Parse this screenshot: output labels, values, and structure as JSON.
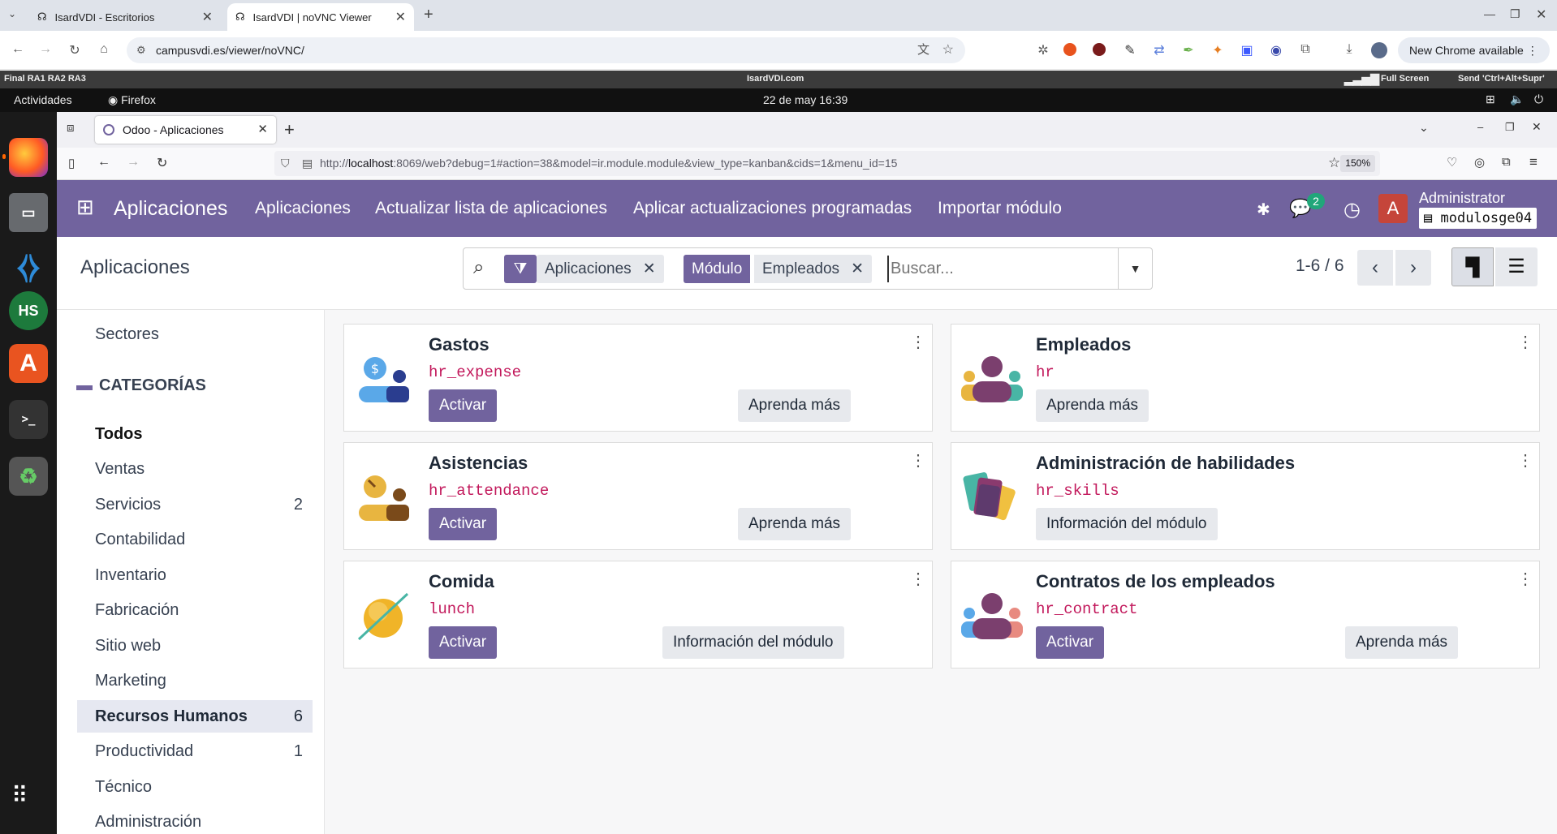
{
  "chrome": {
    "tabs": [
      {
        "title": "IsardVDI - Escritorios"
      },
      {
        "title": "IsardVDI | noVNC Viewer"
      }
    ],
    "url": "campusvdi.es/viewer/noVNC/",
    "new_chrome": "New Chrome available"
  },
  "vnc": {
    "left": "Final RA1 RA2 RA3",
    "center": "IsardVDI.com",
    "fullscreen": "Full Screen",
    "send": "Send 'Ctrl+Alt+Supr'"
  },
  "gnome": {
    "activities": "Actividades",
    "app": "Firefox",
    "datetime": "22 de may  16:39"
  },
  "firefox": {
    "tab_title": "Odoo - Aplicaciones",
    "url_prefix": "http://",
    "url_host": "localhost",
    "url_rest": ":8069/web?debug=1#action=38&model=ir.module.module&view_type=kanban&cids=1&menu_id=15",
    "zoom": "150%"
  },
  "odoo": {
    "brand": "Aplicaciones",
    "menu": [
      "Aplicaciones",
      "Actualizar lista de aplicaciones",
      "Aplicar actualizaciones programadas",
      "Importar módulo"
    ],
    "chat_count": "2",
    "user_initial": "A",
    "user_name": "Administrator",
    "db_name": "modulosge04",
    "breadcrumb": "Aplicaciones",
    "facets": {
      "filter_value": "Aplicaciones",
      "group_label": "Módulo",
      "group_value": "Empleados"
    },
    "search_placeholder": "Buscar...",
    "pager": "1-6 / 6",
    "sidebar": {
      "sectores": "Sectores",
      "categorias_title": "CATEGORÍAS",
      "items": [
        {
          "label": "Todos",
          "count": ""
        },
        {
          "label": "Ventas",
          "count": ""
        },
        {
          "label": "Servicios",
          "count": "2"
        },
        {
          "label": "Contabilidad",
          "count": ""
        },
        {
          "label": "Inventario",
          "count": ""
        },
        {
          "label": "Fabricación",
          "count": ""
        },
        {
          "label": "Sitio web",
          "count": ""
        },
        {
          "label": "Marketing",
          "count": ""
        },
        {
          "label": "Recursos Humanos",
          "count": "6"
        },
        {
          "label": "Productividad",
          "count": "1"
        },
        {
          "label": "Técnico",
          "count": ""
        },
        {
          "label": "Administración",
          "count": ""
        }
      ]
    },
    "cards": [
      {
        "title": "Gastos",
        "tech": "hr_expense",
        "primary": "Activar",
        "secondary": "Aprenda más"
      },
      {
        "title": "Empleados",
        "tech": "hr",
        "primary": "",
        "secondary": "Aprenda más"
      },
      {
        "title": "Asistencias",
        "tech": "hr_attendance",
        "primary": "Activar",
        "secondary": "Aprenda más"
      },
      {
        "title": "Administración de habilidades",
        "tech": "hr_skills",
        "primary": "",
        "secondary": "Información del módulo"
      },
      {
        "title": "Comida",
        "tech": "lunch",
        "primary": "Activar",
        "secondary": "Información del módulo"
      },
      {
        "title": "Contratos de los empleados",
        "tech": "hr_contract",
        "primary": "Activar",
        "secondary": "Aprenda más"
      }
    ]
  }
}
